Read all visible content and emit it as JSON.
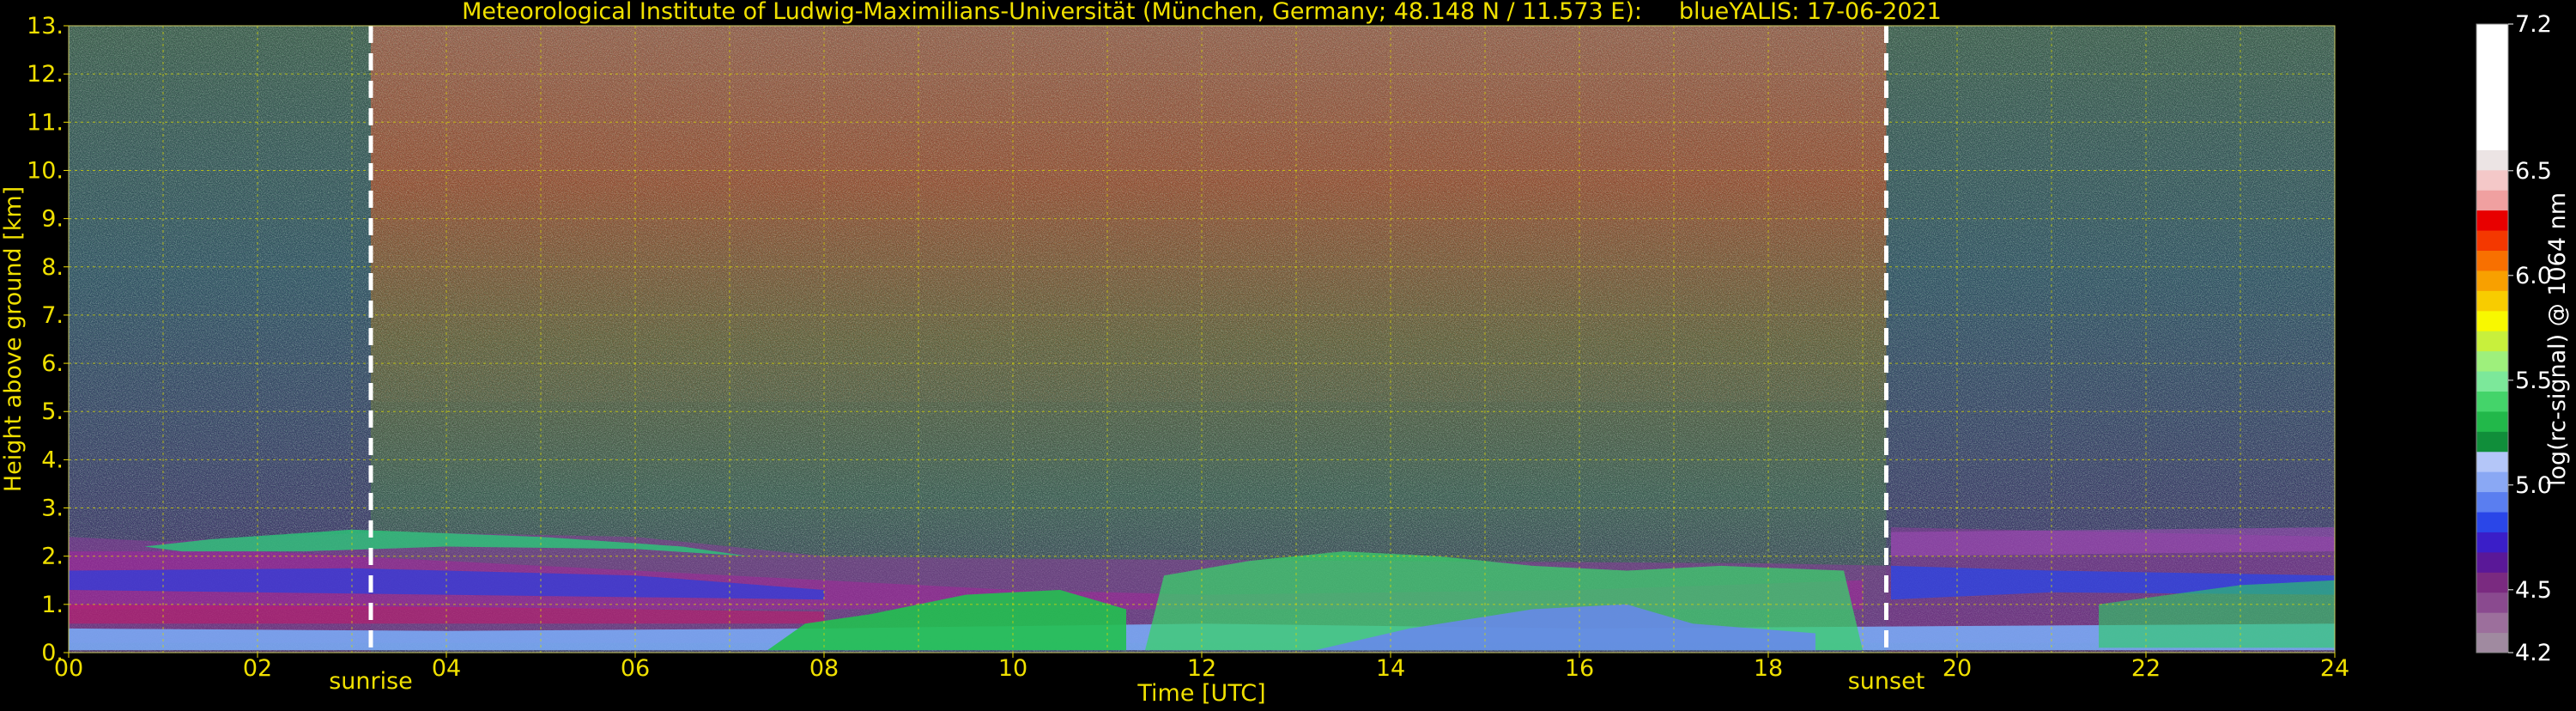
{
  "chart_data": {
    "type": "heatmap",
    "title": "Meteorological Institute of Ludwig-Maximilians-Universität (München, Germany; 48.148 N / 11.573 E):     blueYALIS: 17-06-2021",
    "xlabel": "Time [UTC]",
    "ylabel": "Height above ground [km]",
    "xlim": [
      0,
      24
    ],
    "ylim": [
      0,
      13
    ],
    "x_ticks": [
      "00",
      "02",
      "04",
      "06",
      "08",
      "10",
      "12",
      "14",
      "16",
      "18",
      "20",
      "22",
      "24"
    ],
    "y_ticks": [
      "0.",
      "1.",
      "2.",
      "3.",
      "4.",
      "5.",
      "6.",
      "7.",
      "8.",
      "9.",
      "10.",
      "11.",
      "12.",
      "13."
    ],
    "grid": true,
    "colorbar": {
      "label": "log(rc-signal) @ 1064 nm",
      "range": [
        4.2,
        7.2
      ],
      "ticks": [
        "4.2",
        "4.5",
        "5.0",
        "5.5",
        "6.0",
        "6.5",
        "7.2"
      ],
      "colors": [
        "#a08aa0",
        "#9c6f9c",
        "#8a4a8f",
        "#7a2a80",
        "#5a1898",
        "#3a1ec8",
        "#2a46e8",
        "#5a7ef0",
        "#8aa8f4",
        "#b4c6f8",
        "#108e3a",
        "#22b84a",
        "#44d46a",
        "#7ce89a",
        "#9ef07c",
        "#c8f03c",
        "#f8f800",
        "#f8cc00",
        "#f8a000",
        "#f87000",
        "#f43800",
        "#e80000",
        "#f0a0a0",
        "#f4c8c8",
        "#ece4e4",
        "#ffffff"
      ]
    },
    "markers": [
      {
        "label": "sunrise",
        "x": 3.2
      },
      {
        "label": "sunset",
        "x": 19.25
      }
    ]
  }
}
